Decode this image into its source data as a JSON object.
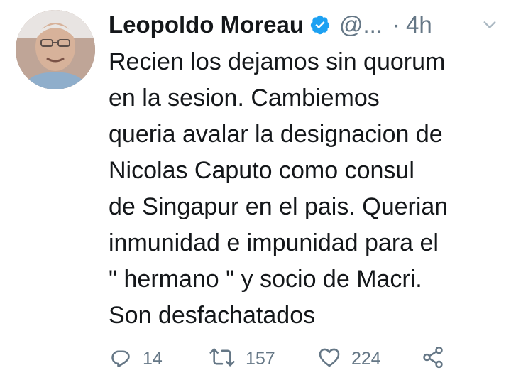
{
  "tweet": {
    "author_name": "Leopoldo Moreau",
    "handle": "@...",
    "separator": "·",
    "time": "4h",
    "lines": [
      "Recien los dejamos sin quorum",
      "en la sesion. Cambiemos",
      "queria avalar la designacion de",
      "Nicolas Caputo como consul",
      "de Singapur en el pais. Querian",
      "inmunidad e impunidad para el",
      "\" hermano \" y socio de Macri.",
      "Son desfachatados"
    ],
    "counts": {
      "replies": "14",
      "retweets": "157",
      "likes": "224"
    }
  },
  "icons": {
    "verified": "verified-badge-icon",
    "caret": "chevron-down-icon",
    "reply": "reply-icon",
    "retweet": "retweet-icon",
    "like": "heart-icon",
    "share": "share-icon"
  },
  "colors": {
    "text": "#14171a",
    "secondary": "#657786",
    "verified": "#1da1f2"
  }
}
